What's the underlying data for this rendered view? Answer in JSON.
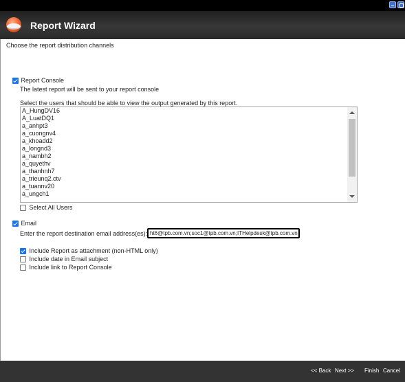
{
  "window": {
    "minimize_icon": "minimize-icon",
    "restore_icon": "restore-icon"
  },
  "header": {
    "title": "Report Wizard",
    "logo_icon": "report-wizard-logo-icon"
  },
  "subtitle": "Choose the report distribution channels",
  "report_console": {
    "label": "Report Console",
    "checked": true,
    "description": "The latest report will be sent to your report console",
    "users_prompt": "Select the users that should be able to view the output generated by this report.",
    "users": [
      "A_HungDV16",
      "A_LuatDQ1",
      "a_anhpt3",
      "a_cuongnv4",
      "a_khoadd2",
      "a_longnd3",
      "a_nambh2",
      "a_quyethv",
      "a_thanhnh7",
      "a_trieunq2.ctv",
      "a_tuannv20",
      "a_ungch1"
    ],
    "select_all_label": "Select All Users",
    "select_all_checked": false
  },
  "email": {
    "label": "Email",
    "checked": true,
    "address_prompt": "Enter the report destination email address(es):",
    "address_value": "ht6@tpb.com.vn;soc1@tpb.com.vn;ITHelpdesk@tpb.com.vn",
    "options": [
      {
        "label": "Include Report as attachment (non-HTML only)",
        "checked": true
      },
      {
        "label": "Include date in Email subject",
        "checked": false
      },
      {
        "label": "Include link to Report Console",
        "checked": false
      }
    ]
  },
  "footer": {
    "back": "<< Back",
    "next": "Next >>",
    "finish": "Finish",
    "cancel": "Cancel"
  },
  "colors": {
    "header_bg": "#2b2b2b",
    "footer_bg": "#333333",
    "checkbox_accent": "#1a73e8"
  }
}
